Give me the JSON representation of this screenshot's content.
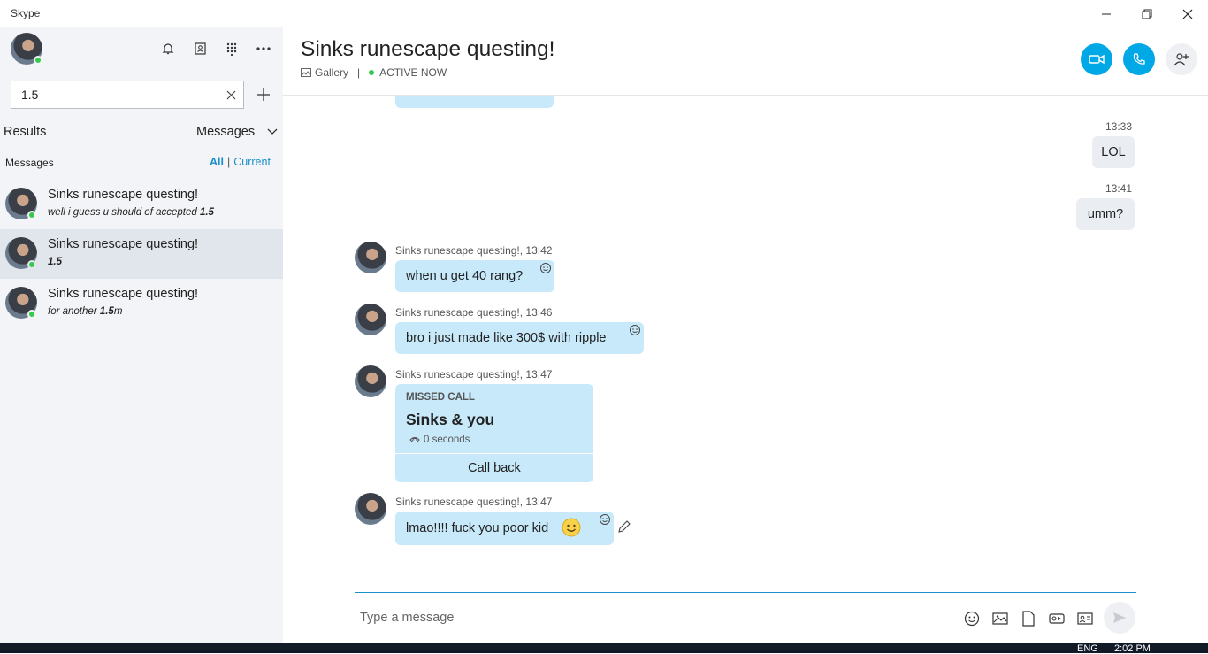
{
  "window": {
    "title": "Skype",
    "controls": {
      "minimize": "minimize-icon",
      "restore": "restore-icon",
      "close": "close-icon"
    }
  },
  "sidebar": {
    "icons": [
      "bell-icon",
      "contacts-icon",
      "dialpad-icon",
      "more-icon"
    ],
    "search": {
      "value": "1.5",
      "clear_icon": "clear-icon",
      "add_icon": "plus-icon"
    },
    "results_label": "Results",
    "filter_label": "Messages",
    "messages_label": "Messages",
    "scope_all": "All",
    "scope_sep": "|",
    "scope_current": "Current",
    "results": [
      {
        "title": "Sinks runescape questing!",
        "snippet_pre": "well i guess u should of accepted ",
        "snippet_hit": "1.5",
        "snippet_post": ""
      },
      {
        "title": "Sinks runescape questing!",
        "snippet_pre": "",
        "snippet_hit": "1.5",
        "snippet_post": ""
      },
      {
        "title": "Sinks runescape questing!",
        "snippet_pre": "for another ",
        "snippet_hit": "1.5",
        "snippet_post": "m"
      }
    ]
  },
  "chat": {
    "title": "Sinks runescape questing!",
    "gallery": "Gallery",
    "separator": "|",
    "status": "ACTIVE NOW",
    "accent": "#00a8e6",
    "messages": {
      "out1": {
        "time": "13:33",
        "text": "LOL"
      },
      "out2": {
        "time": "13:41",
        "text": "umm?"
      },
      "in1": {
        "sender": "Sinks runescape questing!, 13:42",
        "text": "when u get 40 rang?"
      },
      "in2": {
        "sender": "Sinks runescape questing!, 13:46",
        "text": "bro i just made like 300$ with ripple"
      },
      "call": {
        "sender": "Sinks runescape questing!, 13:47",
        "label": "MISSED CALL",
        "title": "Sinks & you",
        "duration": "0 seconds",
        "action": "Call back"
      },
      "in3": {
        "sender": "Sinks runescape questing!, 13:47",
        "text": "lmao!!!! fuck you poor kid"
      }
    },
    "composer": {
      "placeholder": "Type a message"
    }
  },
  "taskbar": {
    "lang": "ENG",
    "time": "2:02 PM"
  }
}
